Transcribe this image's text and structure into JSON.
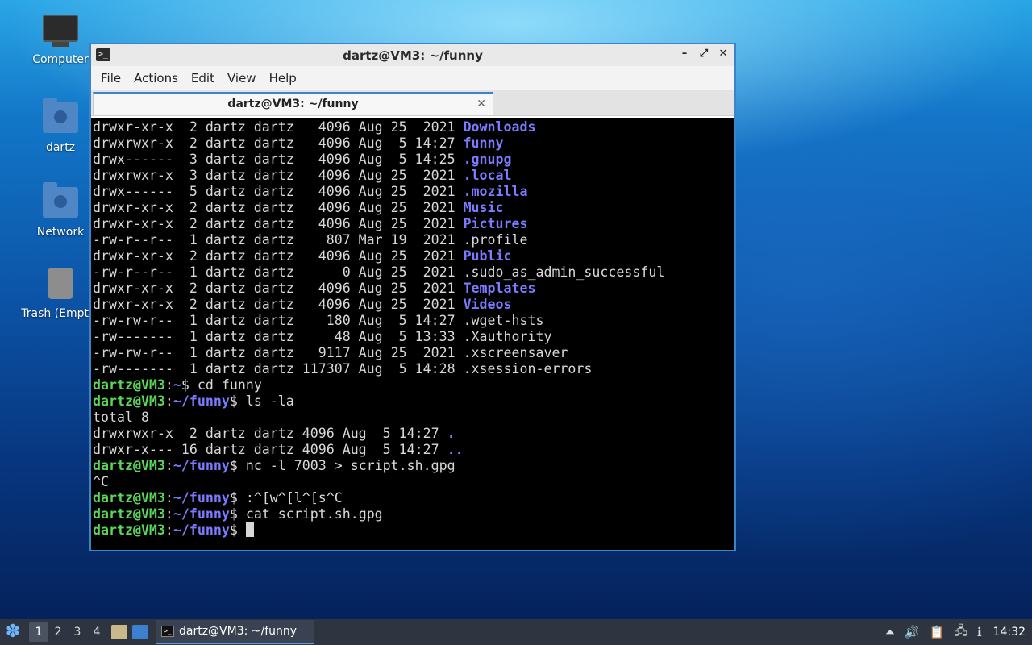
{
  "desktop": {
    "icons": [
      {
        "label": "Computer"
      },
      {
        "label": "dartz"
      },
      {
        "label": "Network"
      },
      {
        "label": "Trash (Empty)"
      }
    ]
  },
  "window": {
    "title": "dartz@VM3: ~/funny",
    "menu": [
      "File",
      "Actions",
      "Edit",
      "View",
      "Help"
    ],
    "tab_title": "dartz@VM3: ~/funny",
    "controls": {
      "minimize": "–",
      "maximize": "⤢",
      "close": "✕"
    }
  },
  "terminal": {
    "lines": [
      {
        "t": "drwxr-xr-x  2 dartz dartz   4096 Aug 25  2021 ",
        "d": "Downloads"
      },
      {
        "t": "drwxrwxr-x  2 dartz dartz   4096 Aug  5 14:27 ",
        "d": "funny"
      },
      {
        "t": "drwx------  3 dartz dartz   4096 Aug  5 14:25 ",
        "d": ".gnupg"
      },
      {
        "t": "drwxrwxr-x  3 dartz dartz   4096 Aug 25  2021 ",
        "d": ".local"
      },
      {
        "t": "drwx------  5 dartz dartz   4096 Aug 25  2021 ",
        "d": ".mozilla"
      },
      {
        "t": "drwxr-xr-x  2 dartz dartz   4096 Aug 25  2021 ",
        "d": "Music"
      },
      {
        "t": "drwxr-xr-x  2 dartz dartz   4096 Aug 25  2021 ",
        "d": "Pictures"
      },
      {
        "t": "-rw-r--r--  1 dartz dartz    807 Mar 19  2021 .profile"
      },
      {
        "t": "drwxr-xr-x  2 dartz dartz   4096 Aug 25  2021 ",
        "d": "Public"
      },
      {
        "t": "-rw-r--r--  1 dartz dartz      0 Aug 25  2021 .sudo_as_admin_successful"
      },
      {
        "t": "drwxr-xr-x  2 dartz dartz   4096 Aug 25  2021 ",
        "d": "Templates"
      },
      {
        "t": "drwxr-xr-x  2 dartz dartz   4096 Aug 25  2021 ",
        "d": "Videos"
      },
      {
        "t": "-rw-rw-r--  1 dartz dartz    180 Aug  5 14:27 .wget-hsts"
      },
      {
        "t": "-rw-------  1 dartz dartz     48 Aug  5 13:33 .Xauthority"
      },
      {
        "t": "-rw-rw-r--  1 dartz dartz   9117 Aug 25  2021 .xscreensaver"
      },
      {
        "t": "-rw-------  1 dartz dartz 117307 Aug  5 14:28 .xsession-errors"
      },
      {
        "p": "dartz@VM3",
        "path": "~",
        "cmd": "$ cd funny"
      },
      {
        "p": "dartz@VM3",
        "path": "~/funny",
        "cmd": "$ ls -la"
      },
      {
        "t": "total 8"
      },
      {
        "t": "drwxrwxr-x  2 dartz dartz 4096 Aug  5 14:27 ",
        "d": "."
      },
      {
        "t": "drwxr-x--- 16 dartz dartz 4096 Aug  5 14:27 ",
        "d": ".."
      },
      {
        "p": "dartz@VM3",
        "path": "~/funny",
        "cmd": "$ nc -l 7003 > script.sh.gpg"
      },
      {
        "t": "^C"
      },
      {
        "p": "dartz@VM3",
        "path": "~/funny",
        "cmd": "$ :^[w^[l^[s^C"
      },
      {
        "p": "dartz@VM3",
        "path": "~/funny",
        "cmd": "$ cat script.sh.gpg"
      },
      {
        "p": "dartz@VM3",
        "path": "~/funny",
        "cmd": "$ ",
        "cursor": true
      }
    ]
  },
  "taskbar": {
    "workspaces": [
      "1",
      "2",
      "3",
      "4"
    ],
    "active_workspace": "1",
    "task_label": "dartz@VM3: ~/funny",
    "clock": "14:32"
  }
}
